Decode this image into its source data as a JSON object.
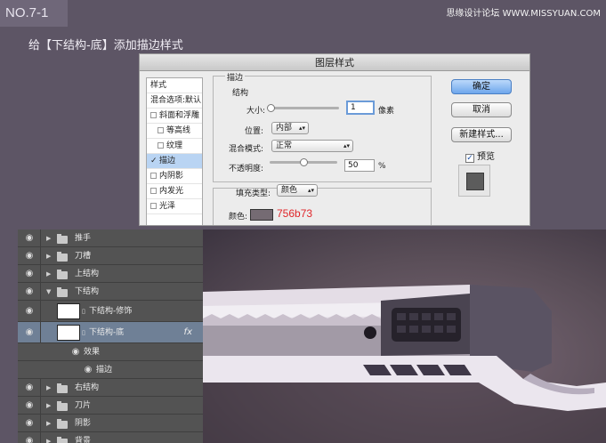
{
  "step_tag": "NO.7-1",
  "watermark": "思缘设计论坛 WWW.MISSYUAN.COM",
  "instruction": "给【下结构-底】添加描边样式",
  "dialog": {
    "title": "图层样式",
    "style_list": {
      "header": "样式",
      "blend_defaults": "混合选项:默认",
      "items": [
        {
          "label": "斜面和浮雕",
          "checked": false
        },
        {
          "label": "等高线",
          "checked": false
        },
        {
          "label": "纹理",
          "checked": false
        },
        {
          "label": "描边",
          "checked": true
        },
        {
          "label": "内阴影",
          "checked": false
        },
        {
          "label": "内发光",
          "checked": false
        },
        {
          "label": "光泽",
          "checked": false
        }
      ]
    },
    "stroke_group": "描边",
    "structure_group": "结构",
    "size_label": "大小:",
    "size_value": "1",
    "size_unit": "像素",
    "position_label": "位置:",
    "position_value": "内部",
    "blend_mode_label": "混合模式:",
    "blend_mode_value": "正常",
    "opacity_label": "不透明度:",
    "opacity_value": "50",
    "opacity_unit": "%",
    "fill_type_label": "填充类型:",
    "fill_type_value": "颜色",
    "color_label": "颜色:",
    "color_hex": "756b73",
    "color_swatch": "#756b73",
    "buttons": {
      "ok": "确定",
      "cancel": "取消",
      "new_style": "新建样式..."
    },
    "preview_label": "预览",
    "preview_checked": true
  },
  "layers": [
    {
      "name": "推手",
      "type": "folder",
      "expanded": false
    },
    {
      "name": "刀槽",
      "type": "folder",
      "expanded": false
    },
    {
      "name": "上结构",
      "type": "folder",
      "expanded": false
    },
    {
      "name": "下结构",
      "type": "folder",
      "expanded": true
    },
    {
      "name": "下结构-修饰",
      "type": "layer",
      "indent": 1
    },
    {
      "name": "下结构-底",
      "type": "layer",
      "indent": 1,
      "selected": true,
      "fx": "fx"
    },
    {
      "name": "效果",
      "type": "effect",
      "indent": 2
    },
    {
      "name": "描边",
      "type": "effect",
      "indent": 3
    },
    {
      "name": "右结构",
      "type": "folder",
      "expanded": false
    },
    {
      "name": "刀片",
      "type": "folder",
      "expanded": false
    },
    {
      "name": "阴影",
      "type": "folder",
      "expanded": false
    },
    {
      "name": "背景",
      "type": "folder",
      "expanded": false
    }
  ],
  "colors": {
    "page_bg": "#5d5565",
    "panel_bg": "#535353",
    "selected_row": "#6f8096",
    "artboard": "#5a4e58",
    "accent": "#e0262a"
  }
}
